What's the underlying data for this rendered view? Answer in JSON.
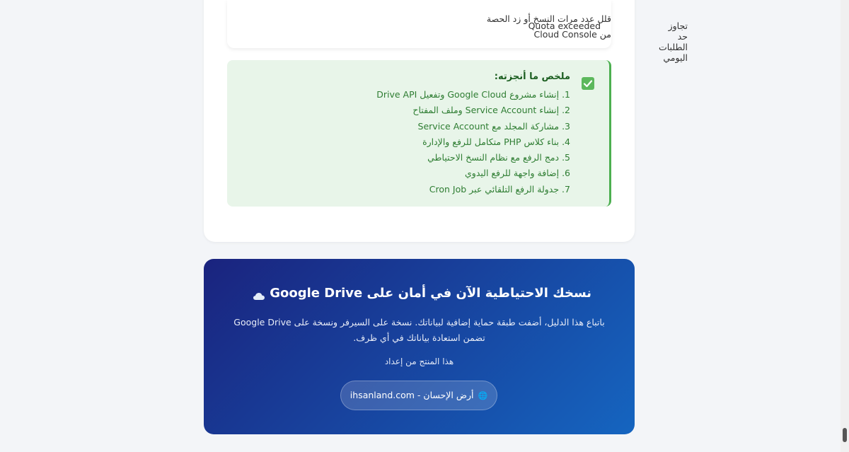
{
  "error_table": {
    "row": {
      "error": "Quota exceeded",
      "cause": "تجاوز حد الطلبات اليومي",
      "solution": "قلل عدد مرات النسخ أو زد الحصة من Cloud Console"
    }
  },
  "summary": {
    "icon": "check-box-icon",
    "title": "ملخص ما أنجزته:",
    "items": [
      "1. إنشاء مشروع Google Cloud وتفعيل Drive API",
      "2. إنشاء Service Account وملف المفتاح",
      "3. مشاركة المجلد مع Service Account",
      "4. بناء كلاس PHP متكامل للرفع والإدارة",
      "5. دمج الرفع مع نظام النسخ الاحتياطي",
      "6. إضافة واجهة للرفع اليدوي",
      "7. جدولة الرفع التلقائي عبر Cron Job"
    ]
  },
  "banner": {
    "icon": "cloud-icon",
    "title": "نسخك الاحتياطية الآن في أمان على Google Drive",
    "text": "باتباع هذا الدليل، أضفت طبقة حماية إضافية لبياناتك. نسخة على السيرفر ونسخة على Google Drive تضمن استعادة بياناتك في أي ظرف.",
    "produced_by": "هذا المنتج من إعداد",
    "link": {
      "icon": "globe-icon",
      "label": "أرض الإحسان - ihsanland.com"
    }
  },
  "colors": {
    "summary_bg": "#e8f5e9",
    "summary_border": "#4caf50",
    "banner_start": "#1a237e",
    "banner_end": "#1565c0"
  }
}
